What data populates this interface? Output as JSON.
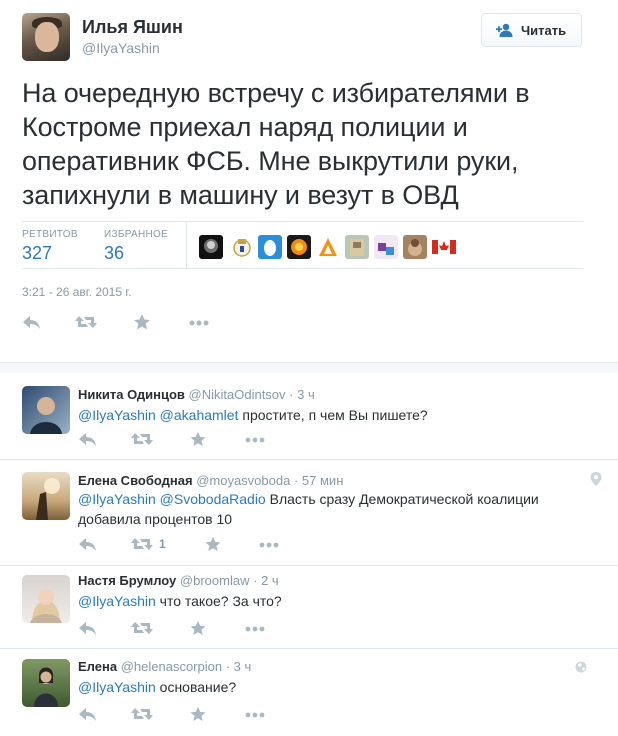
{
  "main_tweet": {
    "author_name": "Илья Яшин",
    "author_handle": "@IlyaYashin",
    "follow_label": "Читать",
    "text_lines": [
      "На очередную встречу с избирателями в",
      "Костроме приехал наряд полиции и",
      "оперативник ФСБ. Мне выкрутили руки,",
      "запихнули в машину и везут в ОВД"
    ],
    "stats": {
      "retweets_label": "РЕТВИТОВ",
      "retweets_value": "327",
      "favorites_label": "ИЗБРАННОЕ",
      "favorites_value": "36"
    },
    "timestamp": "3:21 - 26 авг. 2015 г."
  },
  "replies": [
    {
      "name": "Никита Одинцов",
      "handle": "@NikitaOdintsov",
      "dot": "·",
      "time": "3 ч",
      "mentions": [
        "@IlyaYashin",
        "@akahamlet"
      ],
      "text": "простите, п чем Вы пишете?",
      "retweet_count": ""
    },
    {
      "name": "Елена Свободная",
      "handle": "@moyasvoboda",
      "dot": "·",
      "time": "57 мин",
      "mentions": [
        "@IlyaYashin",
        "@SvobodaRadio"
      ],
      "text": "Власть сразу Демократической коалиции",
      "text_line2": "добавила процентов 10",
      "retweet_count": "1",
      "icon": "location-pin-icon"
    },
    {
      "name": "Настя Брумлоу",
      "handle": "@broomlaw",
      "dot": "·",
      "time": "2 ч",
      "mentions": [
        "@IlyaYashin"
      ],
      "text": "что такое? За что?",
      "retweet_count": ""
    },
    {
      "name": "Елена",
      "handle": "@helenascorpion",
      "dot": "·",
      "time": "3 ч",
      "mentions": [
        "@IlyaYashin"
      ],
      "text": "основание?",
      "retweet_count": "",
      "icon": "globe-icon"
    }
  ],
  "colors": {
    "link": "#2b7bb9",
    "muted": "#8899a6",
    "text": "#292f33",
    "border": "#e1e8ed"
  }
}
